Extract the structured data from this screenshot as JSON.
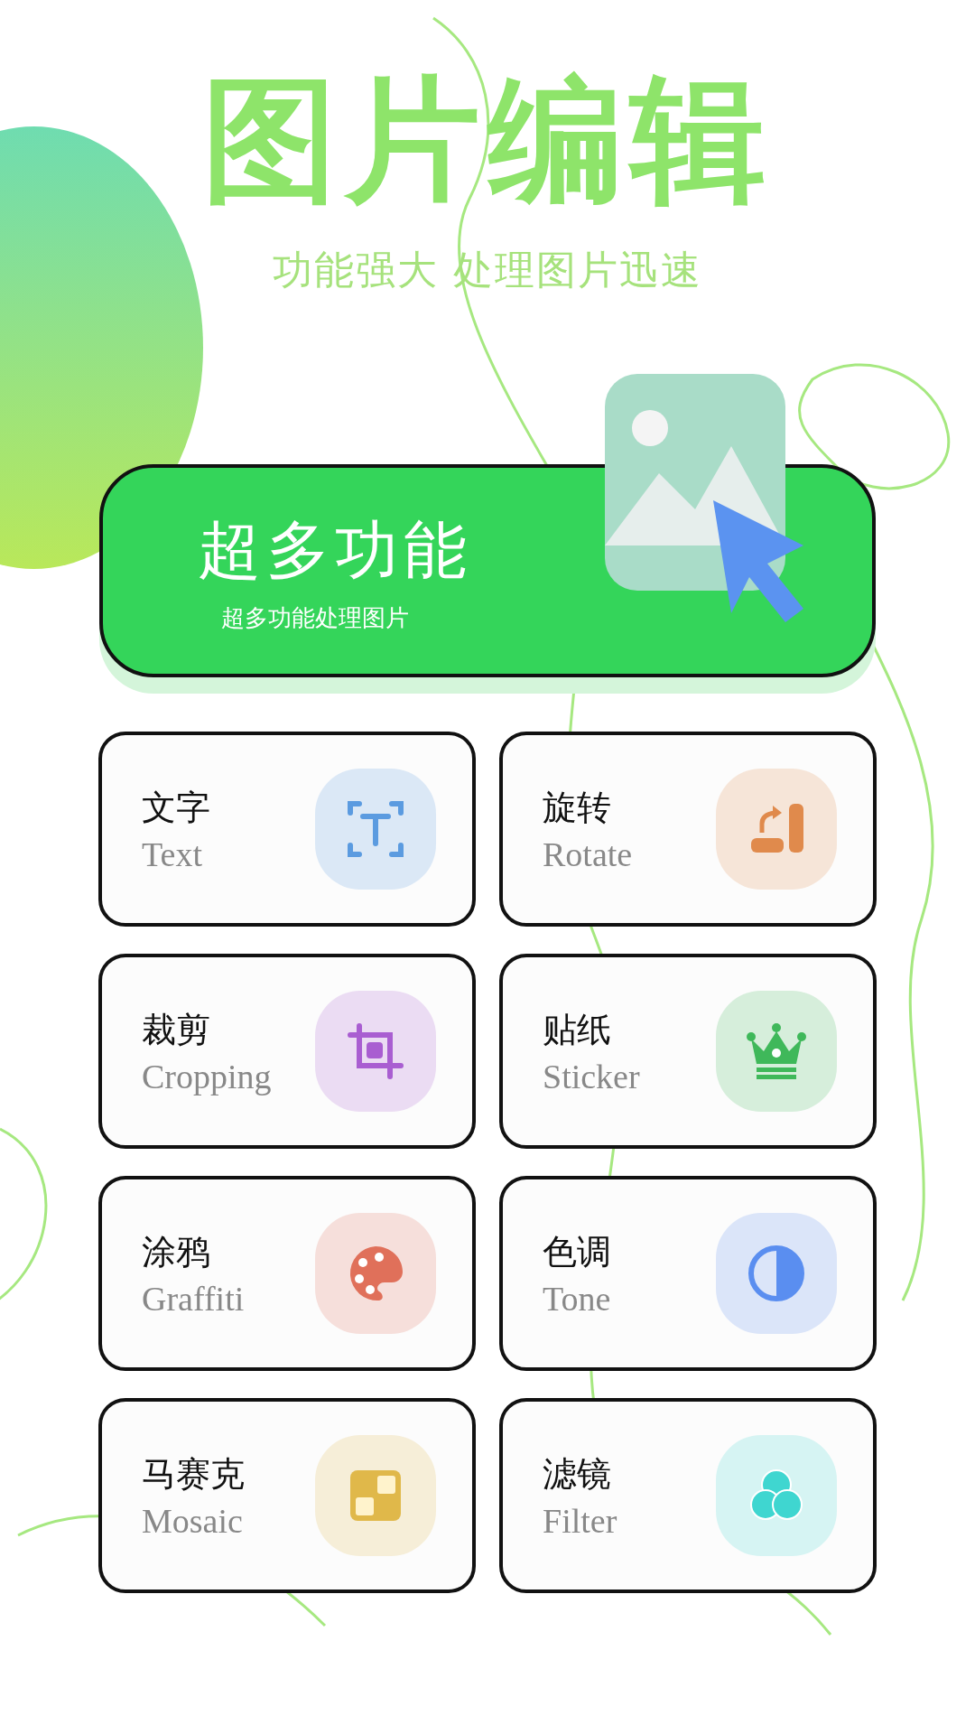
{
  "header": {
    "title": "图片编辑",
    "subtitle": "功能强大 处理图片迅速"
  },
  "banner": {
    "title": "超多功能",
    "subtitle": "超多功能处理图片"
  },
  "tools": [
    {
      "name": "文字",
      "english": "Text",
      "kind": "text",
      "color": "#5b9be0"
    },
    {
      "name": "旋转",
      "english": "Rotate",
      "kind": "rotate",
      "color": "#e08a4c"
    },
    {
      "name": "裁剪",
      "english": "Cropping",
      "kind": "crop",
      "color": "#a95ed1"
    },
    {
      "name": "贴纸",
      "english": "Sticker",
      "kind": "sticker",
      "color": "#3fb85a"
    },
    {
      "name": "涂鸦",
      "english": "Graffiti",
      "kind": "palette",
      "color": "#e0705a"
    },
    {
      "name": "色调",
      "english": "Tone",
      "kind": "tone",
      "color": "#5a8ef0"
    },
    {
      "name": "马赛克",
      "english": "Mosaic",
      "kind": "mosaic",
      "color": "#e0b84a"
    },
    {
      "name": "滤镜",
      "english": "Filter",
      "kind": "filter",
      "color": "#3fd6d0"
    }
  ]
}
